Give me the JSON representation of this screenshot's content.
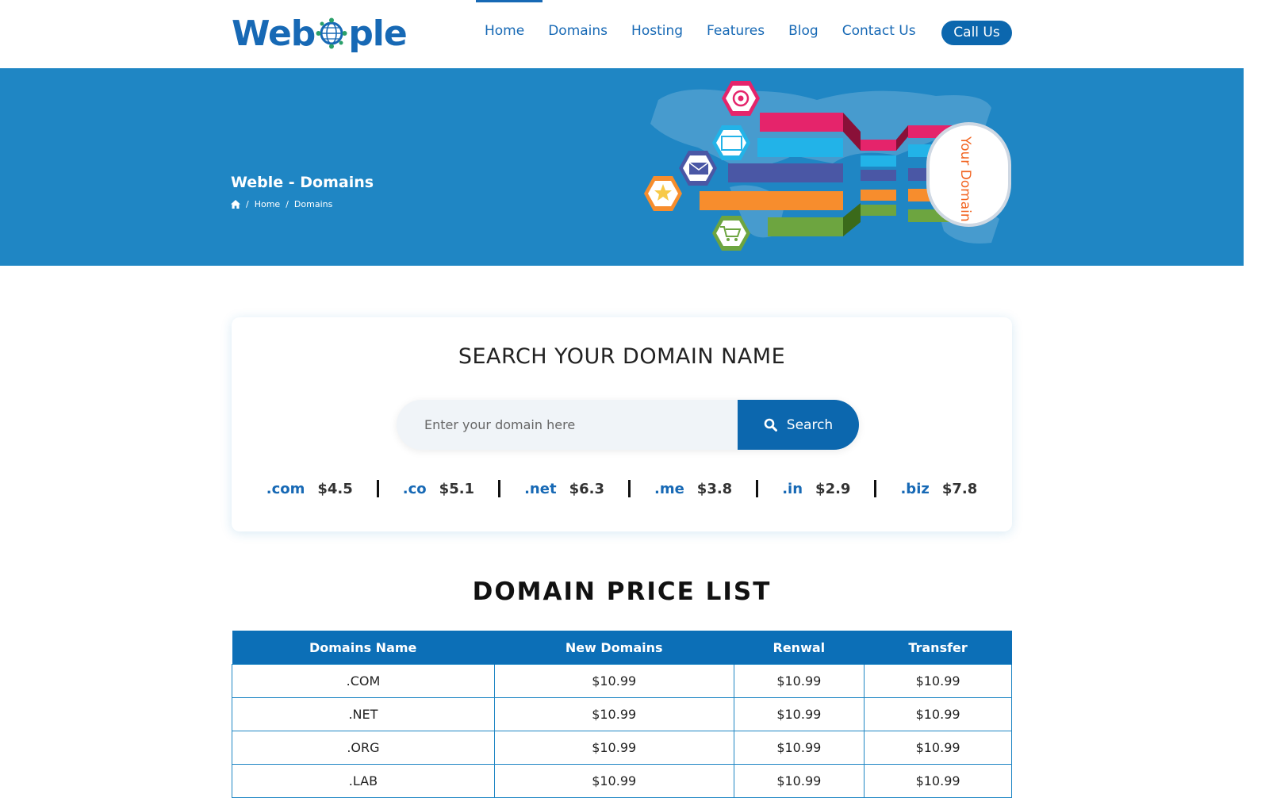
{
  "header": {
    "logo_prefix": "Web",
    "logo_suffix": "ple",
    "nav": [
      "Home",
      "Domains",
      "Hosting",
      "Features",
      "Blog",
      "Contact Us"
    ],
    "active_nav": "Home",
    "call_label": "Call Us"
  },
  "banner": {
    "title": "Weble - Domains",
    "breadcrumb": [
      "Home",
      "Domains"
    ],
    "art_label": "Your Domain"
  },
  "search": {
    "title": "SEARCH YOUR DOMAIN NAME",
    "placeholder": "Enter your domain here",
    "button_label": "Search",
    "tlds": [
      {
        "ext": ".com",
        "price": "$4.5"
      },
      {
        "ext": ".co",
        "price": "$5.1"
      },
      {
        "ext": ".net",
        "price": "$6.3"
      },
      {
        "ext": ".me",
        "price": "$3.8"
      },
      {
        "ext": ".in",
        "price": "$2.9"
      },
      {
        "ext": ".biz",
        "price": "$7.8"
      }
    ]
  },
  "price_list": {
    "title": "DOMAIN PRICE LIST",
    "columns": [
      "Domains Name",
      "New Domains",
      "Renwal",
      "Transfer"
    ],
    "rows": [
      [
        ".COM",
        "$10.99",
        "$10.99",
        "$10.99"
      ],
      [
        ".NET",
        "$10.99",
        "$10.99",
        "$10.99"
      ],
      [
        ".ORG",
        "$10.99",
        "$10.99",
        "$10.99"
      ],
      [
        ".LAB",
        "$10.99",
        "$10.99",
        "$10.99"
      ]
    ]
  },
  "colors": {
    "brand": "#1769b5",
    "banner": "#1f86c4",
    "button": "#0c67ae"
  }
}
